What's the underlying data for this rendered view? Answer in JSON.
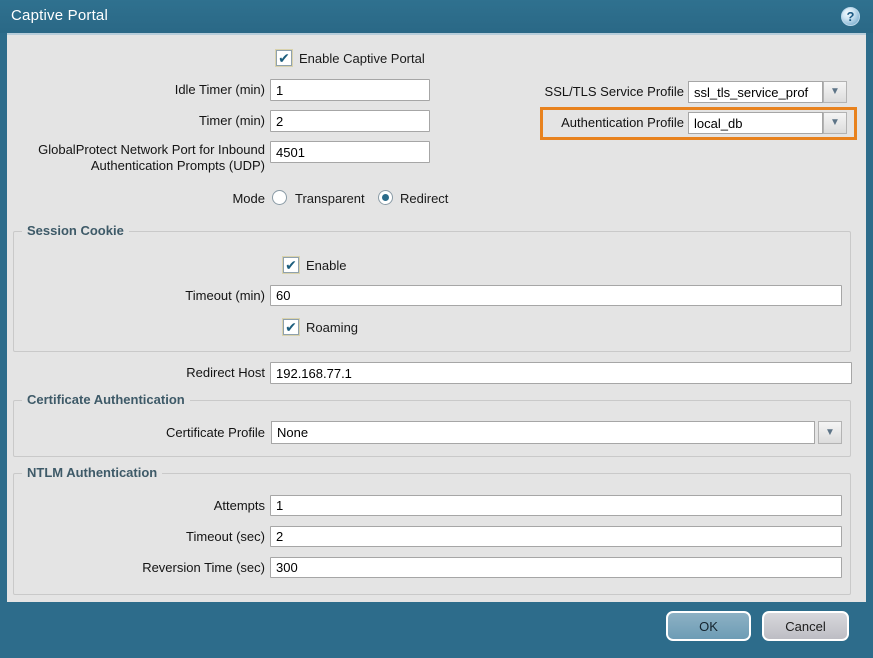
{
  "titlebar": {
    "title": "Captive Portal"
  },
  "icons": {
    "checkmark": "✔",
    "dropdown_arrow": "▼",
    "help": "?"
  },
  "colors": {
    "frame": "#2d6c8b",
    "content_bg": "#e4e4e4",
    "highlight": "#e8821e",
    "accent": "#2a6b8a"
  },
  "general": {
    "enable_checkbox": {
      "label": "Enable Captive Portal",
      "checked": true
    },
    "idle_timer": {
      "label": "Idle Timer (min)",
      "value": "1"
    },
    "timer": {
      "label": "Timer (min)",
      "value": "2"
    },
    "gp_port": {
      "label_line1": "GlobalProtect Network Port for Inbound",
      "label_line2": "Authentication Prompts (UDP)",
      "value": "4501"
    },
    "ssl_tls_profile": {
      "label": "SSL/TLS Service Profile",
      "value": "ssl_tls_service_prof"
    },
    "auth_profile": {
      "label": "Authentication Profile",
      "value": "local_db",
      "highlighted": true
    },
    "mode": {
      "label": "Mode",
      "options": [
        {
          "label": "Transparent",
          "selected": false
        },
        {
          "label": "Redirect",
          "selected": true
        }
      ]
    }
  },
  "session_cookie": {
    "legend": "Session Cookie",
    "enable": {
      "label": "Enable",
      "checked": true
    },
    "timeout": {
      "label": "Timeout (min)",
      "value": "60"
    },
    "roaming": {
      "label": "Roaming",
      "checked": true
    }
  },
  "redirect_host": {
    "label": "Redirect Host",
    "value": "192.168.77.1"
  },
  "certificate_authentication": {
    "legend": "Certificate Authentication",
    "certificate_profile": {
      "label": "Certificate Profile",
      "value": "None"
    }
  },
  "ntlm_authentication": {
    "legend": "NTLM Authentication",
    "attempts": {
      "label": "Attempts",
      "value": "1"
    },
    "timeout": {
      "label": "Timeout (sec)",
      "value": "2"
    },
    "reversion_time": {
      "label": "Reversion Time (sec)",
      "value": "300"
    }
  },
  "footer": {
    "ok_label": "OK",
    "cancel_label": "Cancel"
  }
}
